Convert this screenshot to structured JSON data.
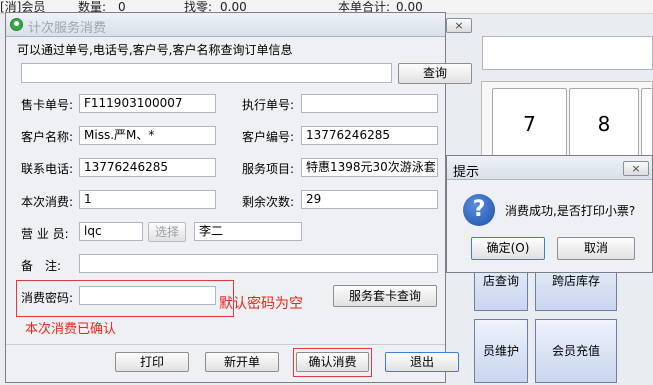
{
  "background": {
    "topbar": {
      "item1": "[消]会员",
      "qty_label": "数量:",
      "qty_value": "0",
      "change_label": "找零:",
      "change_value": "0.00",
      "subtotal_label": "本单合计:",
      "subtotal_value": "0.00"
    },
    "keypad": {
      "key7": "7",
      "key8": "8"
    },
    "buttons": {
      "store_query": "店查询",
      "cross_store_stock": "跨店库存",
      "maintain": "员维护",
      "member_topup": "会员充值"
    }
  },
  "dialog": {
    "title": "计次服务消费",
    "close": "×",
    "hint": "可以通过单号,电话号,客户号,客户名称查询订单信息",
    "search": {
      "value": "",
      "button": "查询"
    },
    "fields": {
      "card_no_label": "售卡单号:",
      "card_no": "F111903100007",
      "exec_no_label": "执行单号:",
      "exec_no": "",
      "customer_name_label": "客户名称:",
      "customer_name": "Miss.严M、*",
      "customer_no_label": "客户编号:",
      "customer_no": "13776246285",
      "phone_label": "联系电话:",
      "phone": "13776246285",
      "service_label": "服务项目:",
      "service": "特惠1398元30次游泳套",
      "consume_label": "本次消费:",
      "consume": "1",
      "remain_label": "剩余次数:",
      "remain": "29",
      "staff_label": "营 业 员:",
      "staff_code": "lqc",
      "staff_select": "选择",
      "staff_name": "李二",
      "note_label": "备　注:",
      "note": "",
      "password_label": "消费密码:",
      "password": ""
    },
    "password_hint": "默认密码为空",
    "package_query": "服务套卡查询",
    "confirmed_text": "本次消费已确认",
    "footer": {
      "print": "打印",
      "new_order": "新开单",
      "confirm": "确认消费",
      "exit": "退出"
    }
  },
  "message_box": {
    "title": "提示",
    "close": "×",
    "icon": "question-icon",
    "text": "消费成功,是否打印小票?",
    "ok": "确定(O)",
    "cancel": "取消"
  }
}
